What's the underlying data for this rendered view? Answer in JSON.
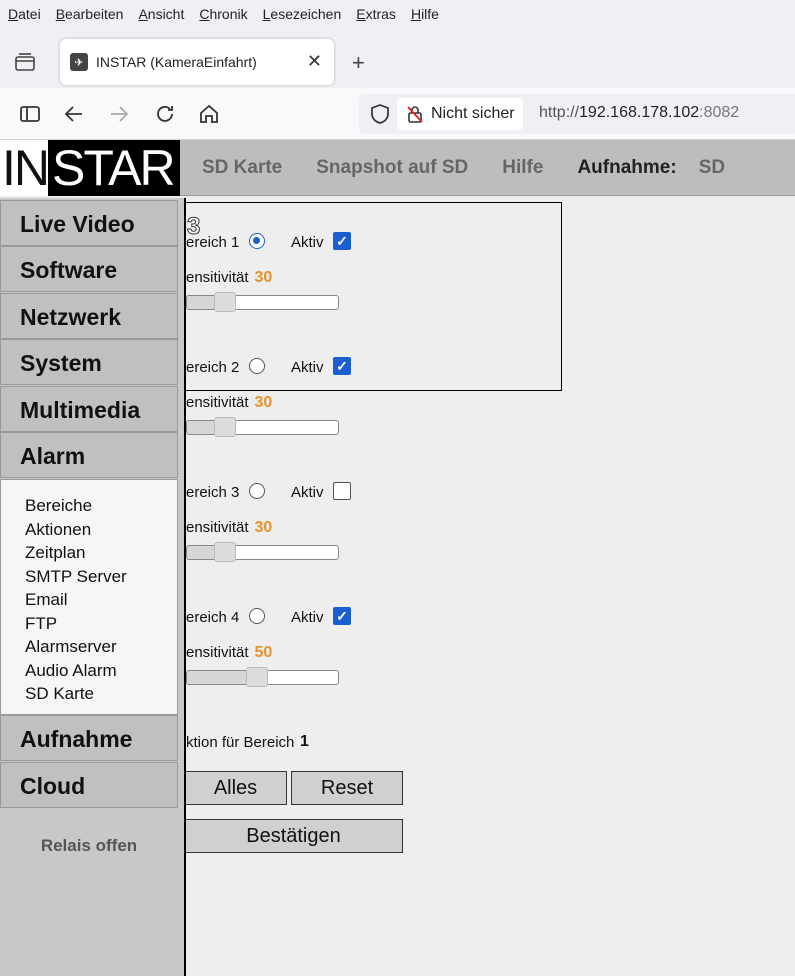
{
  "browser": {
    "menu": [
      "Datei",
      "Bearbeiten",
      "Ansicht",
      "Chronik",
      "Lesezeichen",
      "Extras",
      "Hilfe"
    ],
    "tab_title": "INSTAR (KameraEinfahrt)",
    "security_label": "Nicht sicher",
    "url_scheme": "http://",
    "url_host": "192.168.178.102",
    "url_port": ":8082"
  },
  "header": {
    "logo_in": "IN",
    "logo_star": "STAR",
    "nav": [
      "SD Karte",
      "Snapshot auf SD",
      "Hilfe"
    ],
    "record_label": "Aufnahme:",
    "record_value": "SD"
  },
  "sidebar": {
    "items_top": [
      "Live Video",
      "Software",
      "Netzwerk",
      "System",
      "Multimedia",
      "Alarm"
    ],
    "submenu": [
      "Bereiche",
      "Aktionen",
      "Zeitplan",
      "SMTP Server",
      "Email",
      "FTP",
      "Alarmserver",
      "Audio Alarm",
      "SD Karte"
    ],
    "items_bottom": [
      "Aufnahme",
      "Cloud"
    ],
    "relay": "Relais offen"
  },
  "content": {
    "area_digit": "3",
    "active_label": "Aktiv",
    "areas": [
      {
        "label": "ereich 1",
        "selected": true,
        "active": true,
        "sens_label": "ensitivität",
        "sens_value": "30"
      },
      {
        "label": "ereich 2",
        "selected": false,
        "active": true,
        "sens_label": "ensitivität",
        "sens_value": "30"
      },
      {
        "label": "ereich 3",
        "selected": false,
        "active": false,
        "sens_label": "ensitivität",
        "sens_value": "30"
      },
      {
        "label": "ereich 4",
        "selected": false,
        "active": true,
        "sens_label": "ensitivität",
        "sens_value": "50"
      }
    ],
    "action_label": "ktion für Bereich",
    "action_value": "1",
    "btn_all": "Alles",
    "btn_reset": "Reset",
    "btn_confirm": "Bestätigen"
  }
}
